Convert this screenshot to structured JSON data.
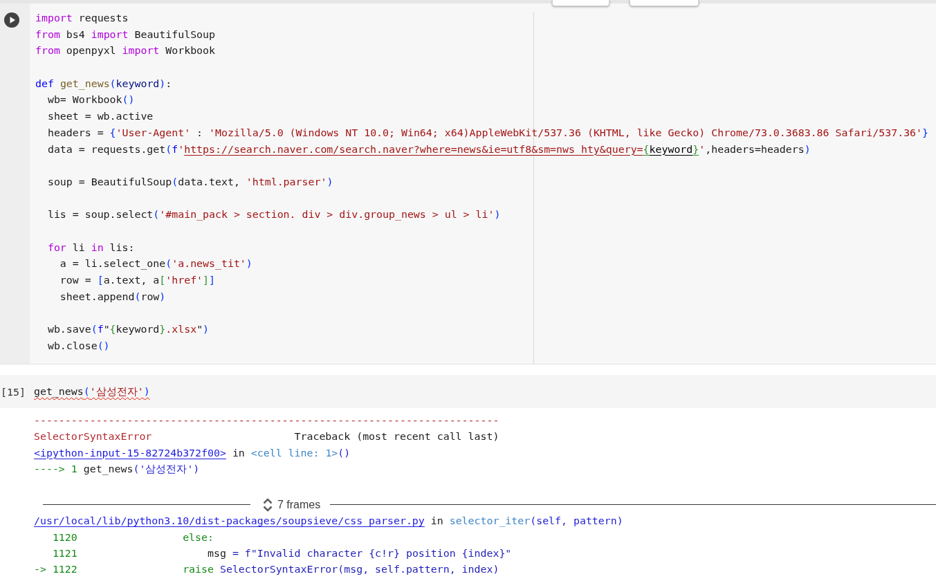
{
  "code_cell": {
    "lines": [
      {
        "kind": "code",
        "tokens": [
          {
            "text": "import",
            "kind": "keyword"
          },
          {
            "text": " requests",
            "kind": "plain"
          }
        ]
      },
      {
        "kind": "code",
        "tokens": [
          {
            "text": "from",
            "kind": "keyword"
          },
          {
            "text": " bs4 ",
            "kind": "plain"
          },
          {
            "text": "import",
            "kind": "keyword"
          },
          {
            "text": " BeautifulSoup",
            "kind": "plain"
          }
        ]
      },
      {
        "kind": "code",
        "tokens": [
          {
            "text": "from",
            "kind": "keyword"
          },
          {
            "text": " openpyxl ",
            "kind": "plain"
          },
          {
            "text": "import",
            "kind": "keyword"
          },
          {
            "text": " Workbook",
            "kind": "plain"
          }
        ]
      },
      {
        "kind": "blank"
      },
      {
        "kind": "code",
        "tokens": [
          {
            "text": "def ",
            "kind": "def"
          },
          {
            "text": "get_news",
            "kind": "function"
          },
          {
            "text": "(",
            "kind": "bracket"
          },
          {
            "text": "keyword",
            "kind": "parameter"
          },
          {
            "text": ")",
            "kind": "bracket"
          },
          {
            "text": ":",
            "kind": "plain"
          }
        ]
      },
      {
        "kind": "code",
        "tokens": [
          {
            "text": "  wb= Workbook",
            "kind": "plain"
          },
          {
            "text": "()",
            "kind": "bracket"
          }
        ]
      },
      {
        "kind": "code",
        "tokens": [
          {
            "text": "  sheet = wb.active",
            "kind": "plain"
          }
        ]
      },
      {
        "kind": "code",
        "tokens": [
          {
            "text": "  headers = ",
            "kind": "plain"
          },
          {
            "text": "{",
            "kind": "bracket"
          },
          {
            "text": "'User-Agent'",
            "kind": "string"
          },
          {
            "text": " : ",
            "kind": "plain"
          },
          {
            "text": "'Mozilla/5.0 (Windows NT 10.0; Win64; x64)AppleWebKit/537.36 (KHTML, like Gecko) Chrome/73.0.3683.86 Safari/537.36'",
            "kind": "string"
          },
          {
            "text": "}",
            "kind": "bracket"
          }
        ]
      },
      {
        "kind": "code",
        "tokens": [
          {
            "text": "  data = requests.get",
            "kind": "plain"
          },
          {
            "text": "(",
            "kind": "bracket"
          },
          {
            "text": "f",
            "kind": "prefix"
          },
          {
            "text": "'",
            "kind": "string"
          },
          {
            "text": "https://search.naver.com/search.naver?where=news&ie=utf8&sm=nws_hty&query=",
            "kind": "url"
          },
          {
            "text": "{",
            "kind": "urlbrace"
          },
          {
            "text": "keyword",
            "kind": "urlvar"
          },
          {
            "text": "}",
            "kind": "urlbrace"
          },
          {
            "text": "'",
            "kind": "string"
          },
          {
            "text": ",headers=headers",
            "kind": "plain"
          },
          {
            "text": ")",
            "kind": "bracket"
          }
        ]
      },
      {
        "kind": "blank"
      },
      {
        "kind": "code",
        "tokens": [
          {
            "text": "  soup = BeautifulSoup",
            "kind": "plain"
          },
          {
            "text": "(",
            "kind": "bracket"
          },
          {
            "text": "data.text, ",
            "kind": "plain"
          },
          {
            "text": "'html.parser'",
            "kind": "string"
          },
          {
            "text": ")",
            "kind": "bracket"
          }
        ]
      },
      {
        "kind": "blank"
      },
      {
        "kind": "code",
        "tokens": [
          {
            "text": "  lis = soup.select",
            "kind": "plain"
          },
          {
            "text": "(",
            "kind": "bracket"
          },
          {
            "text": "'#main_pack > section. div > div.group_news > ul > li'",
            "kind": "string"
          },
          {
            "text": ")",
            "kind": "bracket"
          }
        ]
      },
      {
        "kind": "blank"
      },
      {
        "kind": "code",
        "tokens": [
          {
            "text": "  for",
            "kind": "keyword"
          },
          {
            "text": " li ",
            "kind": "plain"
          },
          {
            "text": "in",
            "kind": "keyword"
          },
          {
            "text": " lis:",
            "kind": "plain"
          }
        ]
      },
      {
        "kind": "code",
        "tokens": [
          {
            "text": "    a = li.select_one",
            "kind": "plain"
          },
          {
            "text": "(",
            "kind": "bracket"
          },
          {
            "text": "'a.news_tit'",
            "kind": "string"
          },
          {
            "text": ")",
            "kind": "bracket"
          }
        ]
      },
      {
        "kind": "code",
        "tokens": [
          {
            "text": "    row = ",
            "kind": "plain"
          },
          {
            "text": "[",
            "kind": "bracket"
          },
          {
            "text": "a.text, a",
            "kind": "plain"
          },
          {
            "text": "[",
            "kind": "bracket2"
          },
          {
            "text": "'href'",
            "kind": "string"
          },
          {
            "text": "]",
            "kind": "bracket2"
          },
          {
            "text": "]",
            "kind": "bracket"
          }
        ]
      },
      {
        "kind": "code",
        "tokens": [
          {
            "text": "    sheet.append",
            "kind": "plain"
          },
          {
            "text": "(",
            "kind": "bracket"
          },
          {
            "text": "row",
            "kind": "plain"
          },
          {
            "text": ")",
            "kind": "bracket"
          }
        ]
      },
      {
        "kind": "blank"
      },
      {
        "kind": "code",
        "tokens": [
          {
            "text": "  wb.save",
            "kind": "plain"
          },
          {
            "text": "(",
            "kind": "bracket"
          },
          {
            "text": "f",
            "kind": "prefix"
          },
          {
            "text": "\"",
            "kind": "plain"
          },
          {
            "text": "{",
            "kind": "bracket2"
          },
          {
            "text": "keyword",
            "kind": "plain"
          },
          {
            "text": "}",
            "kind": "bracket2"
          },
          {
            "text": ".xlsx",
            "kind": "string"
          },
          {
            "text": "\"",
            "kind": "plain"
          },
          {
            "text": ")",
            "kind": "bracket"
          }
        ]
      },
      {
        "kind": "code",
        "tokens": [
          {
            "text": "  wb.close",
            "kind": "plain"
          },
          {
            "text": "()",
            "kind": "bracket"
          }
        ]
      }
    ]
  },
  "run_cell": {
    "execution_count": "[15]",
    "lint_warning": true,
    "tokens": [
      {
        "text": "get_news",
        "kind": "plain"
      },
      {
        "text": "(",
        "kind": "bracket"
      },
      {
        "text": "'삼성전자'",
        "kind": "string"
      },
      {
        "text": ")",
        "kind": "bracket"
      }
    ]
  },
  "output": {
    "lines": [
      {
        "kind": "text",
        "tokens": [
          {
            "text": "---------------------------------------------------------------------------",
            "kind": "error"
          }
        ]
      },
      {
        "kind": "text",
        "tokens": [
          {
            "text": "SelectorSyntaxError",
            "kind": "error"
          },
          {
            "text": "                       Traceback (most recent call last)",
            "kind": "plain"
          }
        ]
      },
      {
        "kind": "text",
        "tokens": [
          {
            "text": "<ipython-input-15-82724b372f00>",
            "kind": "link"
          },
          {
            "text": " in ",
            "kind": "plain"
          },
          {
            "text": "<cell line: 1>",
            "kind": "func"
          },
          {
            "text": "()",
            "kind": "args"
          }
        ]
      },
      {
        "kind": "text",
        "tokens": [
          {
            "text": "----> 1",
            "kind": "marker"
          },
          {
            "text": " get_news",
            "kind": "plain"
          },
          {
            "text": "('삼성전자')",
            "kind": "args"
          }
        ]
      },
      {
        "kind": "blank"
      },
      {
        "kind": "frames",
        "label": "7 frames"
      },
      {
        "kind": "text",
        "tokens": [
          {
            "text": "/usr/local/lib/python3.10/dist-packages/soupsieve/css_parser.py",
            "kind": "link"
          },
          {
            "text": " in ",
            "kind": "plain"
          },
          {
            "text": "selector_iter",
            "kind": "func"
          },
          {
            "text": "(self, pattern)",
            "kind": "args"
          }
        ]
      },
      {
        "kind": "text",
        "tokens": [
          {
            "text": "   1120                 else:",
            "kind": "marker"
          }
        ]
      },
      {
        "kind": "text",
        "tokens": [
          {
            "text": "   1121",
            "kind": "marker"
          },
          {
            "text": "                     msg",
            "kind": "plain"
          },
          {
            "text": " = f\"Invalid character {c!r} position {index}\"",
            "kind": "code"
          }
        ]
      },
      {
        "kind": "text",
        "tokens": [
          {
            "text": "-> 1122                 raise",
            "kind": "marker"
          },
          {
            "text": " SelectorSyntaxError(msg, self.pattern, index)",
            "kind": "code"
          }
        ]
      }
    ]
  }
}
